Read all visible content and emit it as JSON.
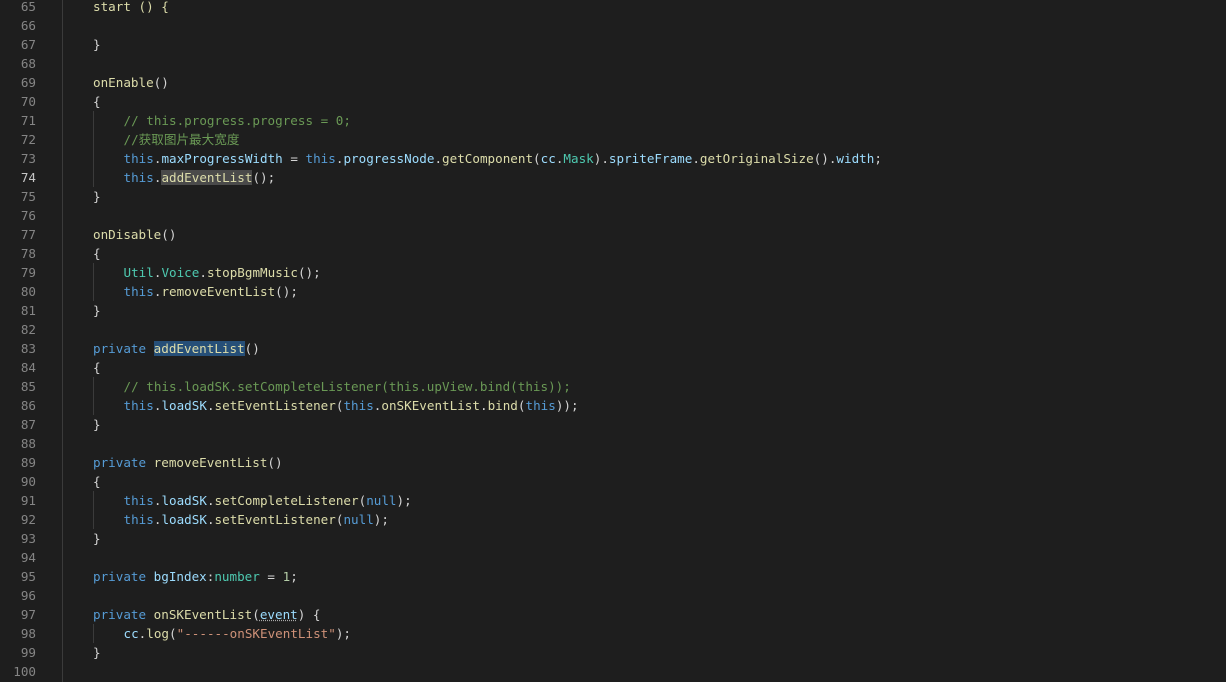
{
  "editor": {
    "active_line": "74",
    "lines": [
      {
        "n": "65",
        "indent": 0,
        "t": [
          [
            "start () {",
            "fn"
          ]
        ]
      },
      {
        "n": "66",
        "indent": 0,
        "t": []
      },
      {
        "n": "67",
        "indent": 0,
        "t": [
          [
            "}",
            "p"
          ]
        ]
      },
      {
        "n": "68",
        "indent": 0,
        "t": []
      },
      {
        "n": "69",
        "indent": 0,
        "t": [
          [
            "onEnable",
            "fn"
          ],
          [
            "()",
            "p"
          ]
        ]
      },
      {
        "n": "70",
        "indent": 0,
        "t": [
          [
            "{",
            "p"
          ]
        ]
      },
      {
        "n": "71",
        "indent": 1,
        "t": [
          [
            "// this.progress.progress = 0;",
            "cmt"
          ]
        ]
      },
      {
        "n": "72",
        "indent": 1,
        "t": [
          [
            "//获取图片最大宽度",
            "cmt"
          ]
        ]
      },
      {
        "n": "73",
        "indent": 1,
        "t": [
          [
            "this",
            "kw"
          ],
          [
            ".",
            "p"
          ],
          [
            "maxProgressWidth",
            "prop"
          ],
          [
            " = ",
            "p"
          ],
          [
            "this",
            "kw"
          ],
          [
            ".",
            "p"
          ],
          [
            "progressNode",
            "prop"
          ],
          [
            ".",
            "p"
          ],
          [
            "getComponent",
            "fn"
          ],
          [
            "(",
            "p"
          ],
          [
            "cc",
            "prop"
          ],
          [
            ".",
            "p"
          ],
          [
            "Mask",
            "type"
          ],
          [
            ").",
            "p"
          ],
          [
            "spriteFrame",
            "prop"
          ],
          [
            ".",
            "p"
          ],
          [
            "getOriginalSize",
            "fn"
          ],
          [
            "().",
            "p"
          ],
          [
            "width",
            "prop"
          ],
          [
            ";",
            "p"
          ]
        ]
      },
      {
        "n": "74",
        "indent": 1,
        "t": [
          [
            "this",
            "kw"
          ],
          [
            ".",
            "p"
          ],
          [
            "addEventList",
            "fn",
            "sel"
          ],
          [
            "();",
            "p"
          ]
        ]
      },
      {
        "n": "75",
        "indent": 0,
        "t": [
          [
            "}",
            "p"
          ]
        ]
      },
      {
        "n": "76",
        "indent": 0,
        "t": []
      },
      {
        "n": "77",
        "indent": 0,
        "t": [
          [
            "onDisable",
            "fn"
          ],
          [
            "()",
            "p"
          ]
        ]
      },
      {
        "n": "78",
        "indent": 0,
        "t": [
          [
            "{",
            "p"
          ]
        ]
      },
      {
        "n": "79",
        "indent": 1,
        "t": [
          [
            "Util",
            "type"
          ],
          [
            ".",
            "p"
          ],
          [
            "Voice",
            "type"
          ],
          [
            ".",
            "p"
          ],
          [
            "stopBgmMusic",
            "fn"
          ],
          [
            "();",
            "p"
          ]
        ]
      },
      {
        "n": "80",
        "indent": 1,
        "t": [
          [
            "this",
            "kw"
          ],
          [
            ".",
            "p"
          ],
          [
            "removeEventList",
            "fn"
          ],
          [
            "();",
            "p"
          ]
        ]
      },
      {
        "n": "81",
        "indent": 0,
        "t": [
          [
            "}",
            "p"
          ]
        ]
      },
      {
        "n": "82",
        "indent": 0,
        "t": []
      },
      {
        "n": "83",
        "indent": 0,
        "t": [
          [
            "private",
            "kw"
          ],
          [
            " ",
            "p"
          ],
          [
            "addEventList",
            "fn",
            "def"
          ],
          [
            "()",
            "p"
          ]
        ]
      },
      {
        "n": "84",
        "indent": 0,
        "t": [
          [
            "{",
            "p"
          ]
        ]
      },
      {
        "n": "85",
        "indent": 1,
        "t": [
          [
            "// this.loadSK.setCompleteListener(this.upView.bind(this));",
            "cmt"
          ]
        ]
      },
      {
        "n": "86",
        "indent": 1,
        "t": [
          [
            "this",
            "kw"
          ],
          [
            ".",
            "p"
          ],
          [
            "loadSK",
            "prop"
          ],
          [
            ".",
            "p"
          ],
          [
            "setEventListener",
            "fn"
          ],
          [
            "(",
            "p"
          ],
          [
            "this",
            "kw"
          ],
          [
            ".",
            "p"
          ],
          [
            "onSKEventList",
            "fn"
          ],
          [
            ".",
            "p"
          ],
          [
            "bind",
            "fn"
          ],
          [
            "(",
            "p"
          ],
          [
            "this",
            "kw"
          ],
          [
            "));",
            "p"
          ]
        ]
      },
      {
        "n": "87",
        "indent": 0,
        "t": [
          [
            "}",
            "p"
          ]
        ]
      },
      {
        "n": "88",
        "indent": 0,
        "t": []
      },
      {
        "n": "89",
        "indent": 0,
        "t": [
          [
            "private",
            "kw"
          ],
          [
            " ",
            "p"
          ],
          [
            "removeEventList",
            "fn"
          ],
          [
            "()",
            "p"
          ]
        ]
      },
      {
        "n": "90",
        "indent": 0,
        "t": [
          [
            "{",
            "p"
          ]
        ]
      },
      {
        "n": "91",
        "indent": 1,
        "t": [
          [
            "this",
            "kw"
          ],
          [
            ".",
            "p"
          ],
          [
            "loadSK",
            "prop"
          ],
          [
            ".",
            "p"
          ],
          [
            "setCompleteListener",
            "fn"
          ],
          [
            "(",
            "p"
          ],
          [
            "null",
            "kw"
          ],
          [
            ");",
            "p"
          ]
        ]
      },
      {
        "n": "92",
        "indent": 1,
        "t": [
          [
            "this",
            "kw"
          ],
          [
            ".",
            "p"
          ],
          [
            "loadSK",
            "prop"
          ],
          [
            ".",
            "p"
          ],
          [
            "setEventListener",
            "fn"
          ],
          [
            "(",
            "p"
          ],
          [
            "null",
            "kw"
          ],
          [
            ");",
            "p"
          ]
        ]
      },
      {
        "n": "93",
        "indent": 0,
        "t": [
          [
            "}",
            "p"
          ]
        ]
      },
      {
        "n": "94",
        "indent": 0,
        "t": []
      },
      {
        "n": "95",
        "indent": 0,
        "t": [
          [
            "private",
            "kw"
          ],
          [
            " ",
            "p"
          ],
          [
            "bgIndex",
            "prop"
          ],
          [
            ":",
            "p"
          ],
          [
            "number",
            "type"
          ],
          [
            " = ",
            "p"
          ],
          [
            "1",
            "num"
          ],
          [
            ";",
            "p"
          ]
        ]
      },
      {
        "n": "96",
        "indent": 0,
        "t": []
      },
      {
        "n": "97",
        "indent": 0,
        "t": [
          [
            "private",
            "kw"
          ],
          [
            " ",
            "p"
          ],
          [
            "onSKEventList",
            "fn"
          ],
          [
            "(",
            "p"
          ],
          [
            "event",
            "prop",
            "ul"
          ],
          [
            ") {",
            "p"
          ]
        ]
      },
      {
        "n": "98",
        "indent": 1,
        "t": [
          [
            "cc",
            "prop"
          ],
          [
            ".",
            "p"
          ],
          [
            "log",
            "fn"
          ],
          [
            "(",
            "p"
          ],
          [
            "\"------onSKEventList\"",
            "str"
          ],
          [
            ");",
            "p"
          ]
        ]
      },
      {
        "n": "99",
        "indent": 0,
        "t": [
          [
            "}",
            "p"
          ]
        ]
      },
      {
        "n": "100",
        "indent": 0,
        "t": []
      }
    ]
  }
}
